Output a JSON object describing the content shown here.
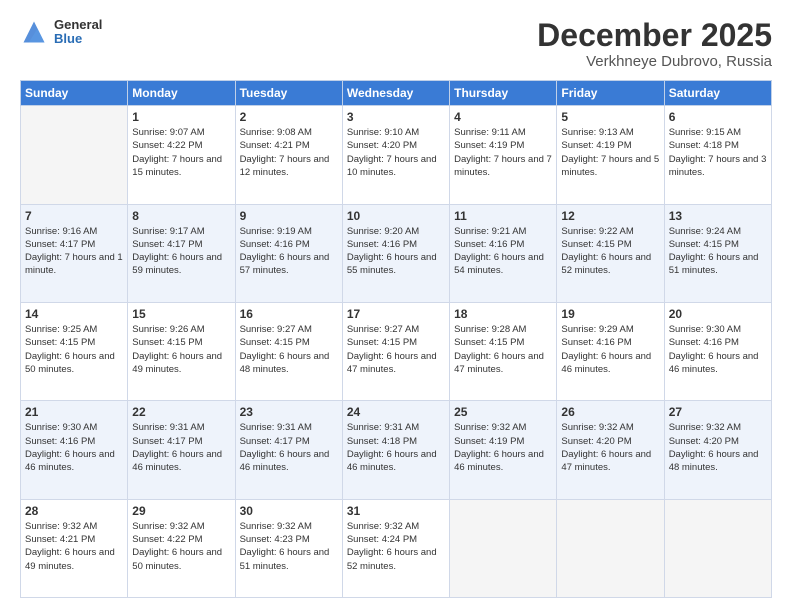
{
  "header": {
    "logo_general": "General",
    "logo_blue": "Blue",
    "month": "December 2025",
    "location": "Verkhneye Dubrovo, Russia"
  },
  "weekdays": [
    "Sunday",
    "Monday",
    "Tuesday",
    "Wednesday",
    "Thursday",
    "Friday",
    "Saturday"
  ],
  "weeks": [
    [
      {
        "day": "",
        "sunrise": "",
        "sunset": "",
        "daylight": ""
      },
      {
        "day": "1",
        "sunrise": "Sunrise: 9:07 AM",
        "sunset": "Sunset: 4:22 PM",
        "daylight": "Daylight: 7 hours and 15 minutes."
      },
      {
        "day": "2",
        "sunrise": "Sunrise: 9:08 AM",
        "sunset": "Sunset: 4:21 PM",
        "daylight": "Daylight: 7 hours and 12 minutes."
      },
      {
        "day": "3",
        "sunrise": "Sunrise: 9:10 AM",
        "sunset": "Sunset: 4:20 PM",
        "daylight": "Daylight: 7 hours and 10 minutes."
      },
      {
        "day": "4",
        "sunrise": "Sunrise: 9:11 AM",
        "sunset": "Sunset: 4:19 PM",
        "daylight": "Daylight: 7 hours and 7 minutes."
      },
      {
        "day": "5",
        "sunrise": "Sunrise: 9:13 AM",
        "sunset": "Sunset: 4:19 PM",
        "daylight": "Daylight: 7 hours and 5 minutes."
      },
      {
        "day": "6",
        "sunrise": "Sunrise: 9:15 AM",
        "sunset": "Sunset: 4:18 PM",
        "daylight": "Daylight: 7 hours and 3 minutes."
      }
    ],
    [
      {
        "day": "7",
        "sunrise": "Sunrise: 9:16 AM",
        "sunset": "Sunset: 4:17 PM",
        "daylight": "Daylight: 7 hours and 1 minute."
      },
      {
        "day": "8",
        "sunrise": "Sunrise: 9:17 AM",
        "sunset": "Sunset: 4:17 PM",
        "daylight": "Daylight: 6 hours and 59 minutes."
      },
      {
        "day": "9",
        "sunrise": "Sunrise: 9:19 AM",
        "sunset": "Sunset: 4:16 PM",
        "daylight": "Daylight: 6 hours and 57 minutes."
      },
      {
        "day": "10",
        "sunrise": "Sunrise: 9:20 AM",
        "sunset": "Sunset: 4:16 PM",
        "daylight": "Daylight: 6 hours and 55 minutes."
      },
      {
        "day": "11",
        "sunrise": "Sunrise: 9:21 AM",
        "sunset": "Sunset: 4:16 PM",
        "daylight": "Daylight: 6 hours and 54 minutes."
      },
      {
        "day": "12",
        "sunrise": "Sunrise: 9:22 AM",
        "sunset": "Sunset: 4:15 PM",
        "daylight": "Daylight: 6 hours and 52 minutes."
      },
      {
        "day": "13",
        "sunrise": "Sunrise: 9:24 AM",
        "sunset": "Sunset: 4:15 PM",
        "daylight": "Daylight: 6 hours and 51 minutes."
      }
    ],
    [
      {
        "day": "14",
        "sunrise": "Sunrise: 9:25 AM",
        "sunset": "Sunset: 4:15 PM",
        "daylight": "Daylight: 6 hours and 50 minutes."
      },
      {
        "day": "15",
        "sunrise": "Sunrise: 9:26 AM",
        "sunset": "Sunset: 4:15 PM",
        "daylight": "Daylight: 6 hours and 49 minutes."
      },
      {
        "day": "16",
        "sunrise": "Sunrise: 9:27 AM",
        "sunset": "Sunset: 4:15 PM",
        "daylight": "Daylight: 6 hours and 48 minutes."
      },
      {
        "day": "17",
        "sunrise": "Sunrise: 9:27 AM",
        "sunset": "Sunset: 4:15 PM",
        "daylight": "Daylight: 6 hours and 47 minutes."
      },
      {
        "day": "18",
        "sunrise": "Sunrise: 9:28 AM",
        "sunset": "Sunset: 4:15 PM",
        "daylight": "Daylight: 6 hours and 47 minutes."
      },
      {
        "day": "19",
        "sunrise": "Sunrise: 9:29 AM",
        "sunset": "Sunset: 4:16 PM",
        "daylight": "Daylight: 6 hours and 46 minutes."
      },
      {
        "day": "20",
        "sunrise": "Sunrise: 9:30 AM",
        "sunset": "Sunset: 4:16 PM",
        "daylight": "Daylight: 6 hours and 46 minutes."
      }
    ],
    [
      {
        "day": "21",
        "sunrise": "Sunrise: 9:30 AM",
        "sunset": "Sunset: 4:16 PM",
        "daylight": "Daylight: 6 hours and 46 minutes."
      },
      {
        "day": "22",
        "sunrise": "Sunrise: 9:31 AM",
        "sunset": "Sunset: 4:17 PM",
        "daylight": "Daylight: 6 hours and 46 minutes."
      },
      {
        "day": "23",
        "sunrise": "Sunrise: 9:31 AM",
        "sunset": "Sunset: 4:17 PM",
        "daylight": "Daylight: 6 hours and 46 minutes."
      },
      {
        "day": "24",
        "sunrise": "Sunrise: 9:31 AM",
        "sunset": "Sunset: 4:18 PM",
        "daylight": "Daylight: 6 hours and 46 minutes."
      },
      {
        "day": "25",
        "sunrise": "Sunrise: 9:32 AM",
        "sunset": "Sunset: 4:19 PM",
        "daylight": "Daylight: 6 hours and 46 minutes."
      },
      {
        "day": "26",
        "sunrise": "Sunrise: 9:32 AM",
        "sunset": "Sunset: 4:20 PM",
        "daylight": "Daylight: 6 hours and 47 minutes."
      },
      {
        "day": "27",
        "sunrise": "Sunrise: 9:32 AM",
        "sunset": "Sunset: 4:20 PM",
        "daylight": "Daylight: 6 hours and 48 minutes."
      }
    ],
    [
      {
        "day": "28",
        "sunrise": "Sunrise: 9:32 AM",
        "sunset": "Sunset: 4:21 PM",
        "daylight": "Daylight: 6 hours and 49 minutes."
      },
      {
        "day": "29",
        "sunrise": "Sunrise: 9:32 AM",
        "sunset": "Sunset: 4:22 PM",
        "daylight": "Daylight: 6 hours and 50 minutes."
      },
      {
        "day": "30",
        "sunrise": "Sunrise: 9:32 AM",
        "sunset": "Sunset: 4:23 PM",
        "daylight": "Daylight: 6 hours and 51 minutes."
      },
      {
        "day": "31",
        "sunrise": "Sunrise: 9:32 AM",
        "sunset": "Sunset: 4:24 PM",
        "daylight": "Daylight: 6 hours and 52 minutes."
      },
      {
        "day": "",
        "sunrise": "",
        "sunset": "",
        "daylight": ""
      },
      {
        "day": "",
        "sunrise": "",
        "sunset": "",
        "daylight": ""
      },
      {
        "day": "",
        "sunrise": "",
        "sunset": "",
        "daylight": ""
      }
    ]
  ]
}
